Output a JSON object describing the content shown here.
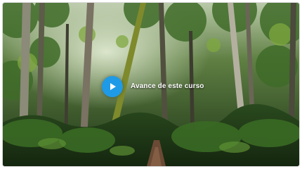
{
  "video": {
    "title": "Avance de este curso",
    "accent_color": "#1f9ae6",
    "play_icon": "play-icon",
    "thumbnail": "forest-trail"
  }
}
